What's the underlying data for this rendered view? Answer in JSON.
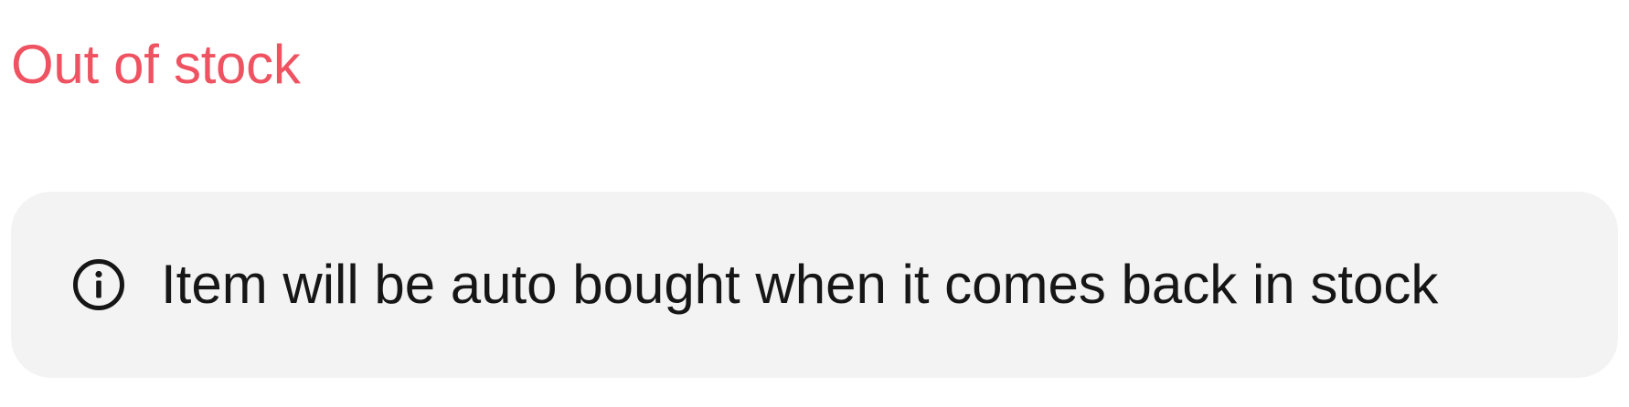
{
  "status": {
    "title": "Out of stock",
    "color": "#ef5261"
  },
  "info_banner": {
    "icon": "info-circle-icon",
    "message": "Item will be auto bought when it comes back in stock",
    "background": "#f3f3f3",
    "text_color": "#161616"
  }
}
